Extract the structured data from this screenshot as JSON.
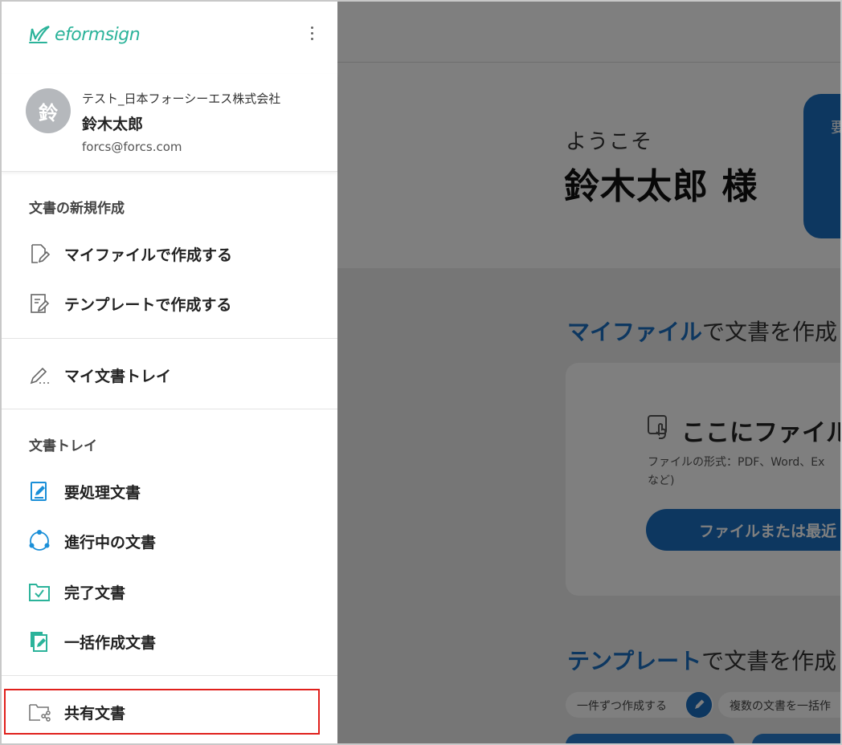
{
  "app": {
    "welcome_label": "ようこそ",
    "welcome_name": "鈴木太郎 様",
    "card_text": "要",
    "myfile_section": {
      "highlight": "マイファイル",
      "rest": "で文書を作成"
    },
    "drop_title": "ここにファイル",
    "drop_desc_line1": "ファイルの形式：PDF、Word、Ex",
    "drop_desc_line2": "など)",
    "drop_button": "ファイルまたは最近",
    "template_section": {
      "highlight": "テンプレート",
      "rest": "で文書を作成"
    },
    "chip_one": "一件ずつ作成する",
    "chip_many": "複数の文書を一括作"
  },
  "drawer": {
    "logo_text": "eformsign",
    "avatar_initial": "鈴",
    "company": "テスト_日本フォーシーエス株式会社",
    "user_name": "鈴木太郎",
    "user_email": "forcs@forcs.com",
    "new_doc_group": "文書の新規作成",
    "create_myfile": "マイファイルで作成する",
    "create_template": "テンプレートで作成する",
    "my_doc_tray": "マイ文書トレイ",
    "doc_tray_group": "文書トレイ",
    "action_required": "要処理文書",
    "in_progress": "進行中の文書",
    "completed": "完了文書",
    "bulk": "一括作成文書",
    "shared": "共有文書"
  },
  "colors": {
    "accent": "#1b6fc0",
    "logo": "#2bb39a",
    "icon_blue": "#1a8fd8",
    "icon_teal": "#2bb39a",
    "highlight": "#e0201c"
  }
}
